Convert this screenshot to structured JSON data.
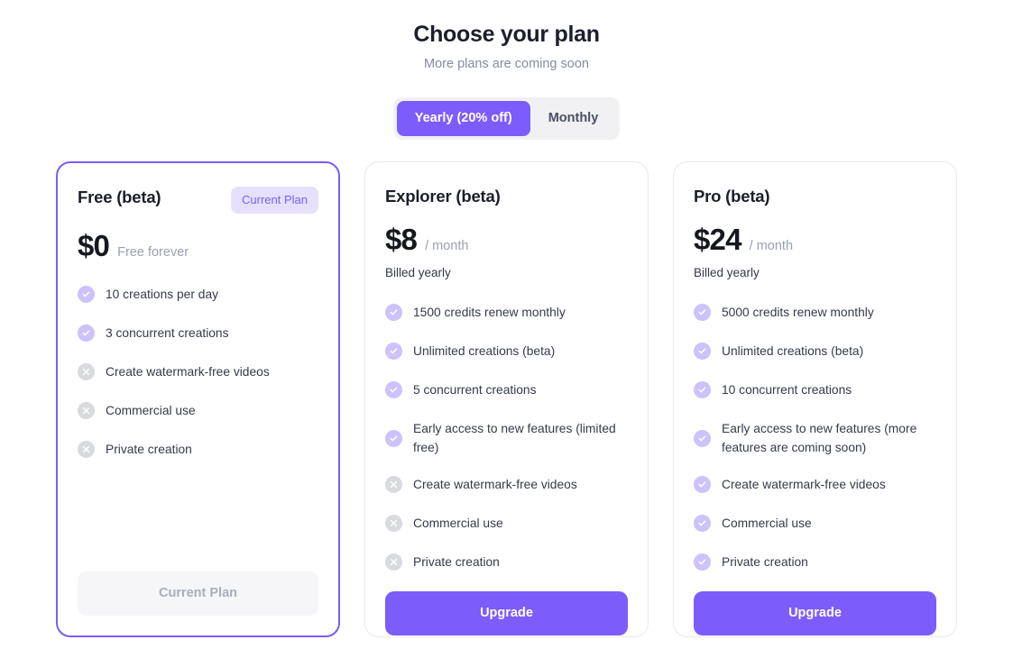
{
  "header": {
    "title": "Choose your plan",
    "subtitle": "More plans are coming soon"
  },
  "billing_toggle": {
    "options": [
      {
        "label": "Yearly (20% off)",
        "active": true
      },
      {
        "label": "Monthly",
        "active": false
      }
    ]
  },
  "colors": {
    "accent": "#7c5cfa",
    "badge_bg": "#e6e0fd",
    "check_circle": "#cdc2fb",
    "cross_circle": "#d9dade",
    "text_primary": "#1c1e2b",
    "text_muted": "#868ba1"
  },
  "plans": [
    {
      "name": "Free (beta)",
      "badge": "Current Plan",
      "price": "$0",
      "price_suffix": "Free forever",
      "billed_note": "",
      "highlighted": true,
      "features": [
        {
          "text": "10 creations per day",
          "included": true
        },
        {
          "text": "3 concurrent creations",
          "included": true
        },
        {
          "text": "Create watermark-free videos",
          "included": false
        },
        {
          "text": "Commercial use",
          "included": false
        },
        {
          "text": "Private creation",
          "included": false
        }
      ],
      "cta": {
        "label": "Current Plan",
        "style": "disabled"
      }
    },
    {
      "name": "Explorer (beta)",
      "badge": "",
      "price": "$8",
      "price_suffix": "/ month",
      "billed_note": "Billed yearly",
      "highlighted": false,
      "features": [
        {
          "text": "1500 credits renew monthly",
          "included": true
        },
        {
          "text": "Unlimited creations (beta)",
          "included": true
        },
        {
          "text": "5 concurrent creations",
          "included": true
        },
        {
          "text": "Early access to new features (limited free)",
          "included": true
        },
        {
          "text": "Create watermark-free videos",
          "included": false
        },
        {
          "text": "Commercial use",
          "included": false
        },
        {
          "text": "Private creation",
          "included": false
        }
      ],
      "cta": {
        "label": "Upgrade",
        "style": "primary"
      }
    },
    {
      "name": "Pro (beta)",
      "badge": "",
      "price": "$24",
      "price_suffix": "/ month",
      "billed_note": "Billed yearly",
      "highlighted": false,
      "features": [
        {
          "text": "5000 credits renew monthly",
          "included": true
        },
        {
          "text": "Unlimited creations (beta)",
          "included": true
        },
        {
          "text": "10 concurrent creations",
          "included": true
        },
        {
          "text": "Early access to new features (more features are coming soon)",
          "included": true
        },
        {
          "text": "Create watermark-free videos",
          "included": true
        },
        {
          "text": "Commercial use",
          "included": true
        },
        {
          "text": "Private creation",
          "included": true
        }
      ],
      "cta": {
        "label": "Upgrade",
        "style": "primary"
      }
    }
  ]
}
